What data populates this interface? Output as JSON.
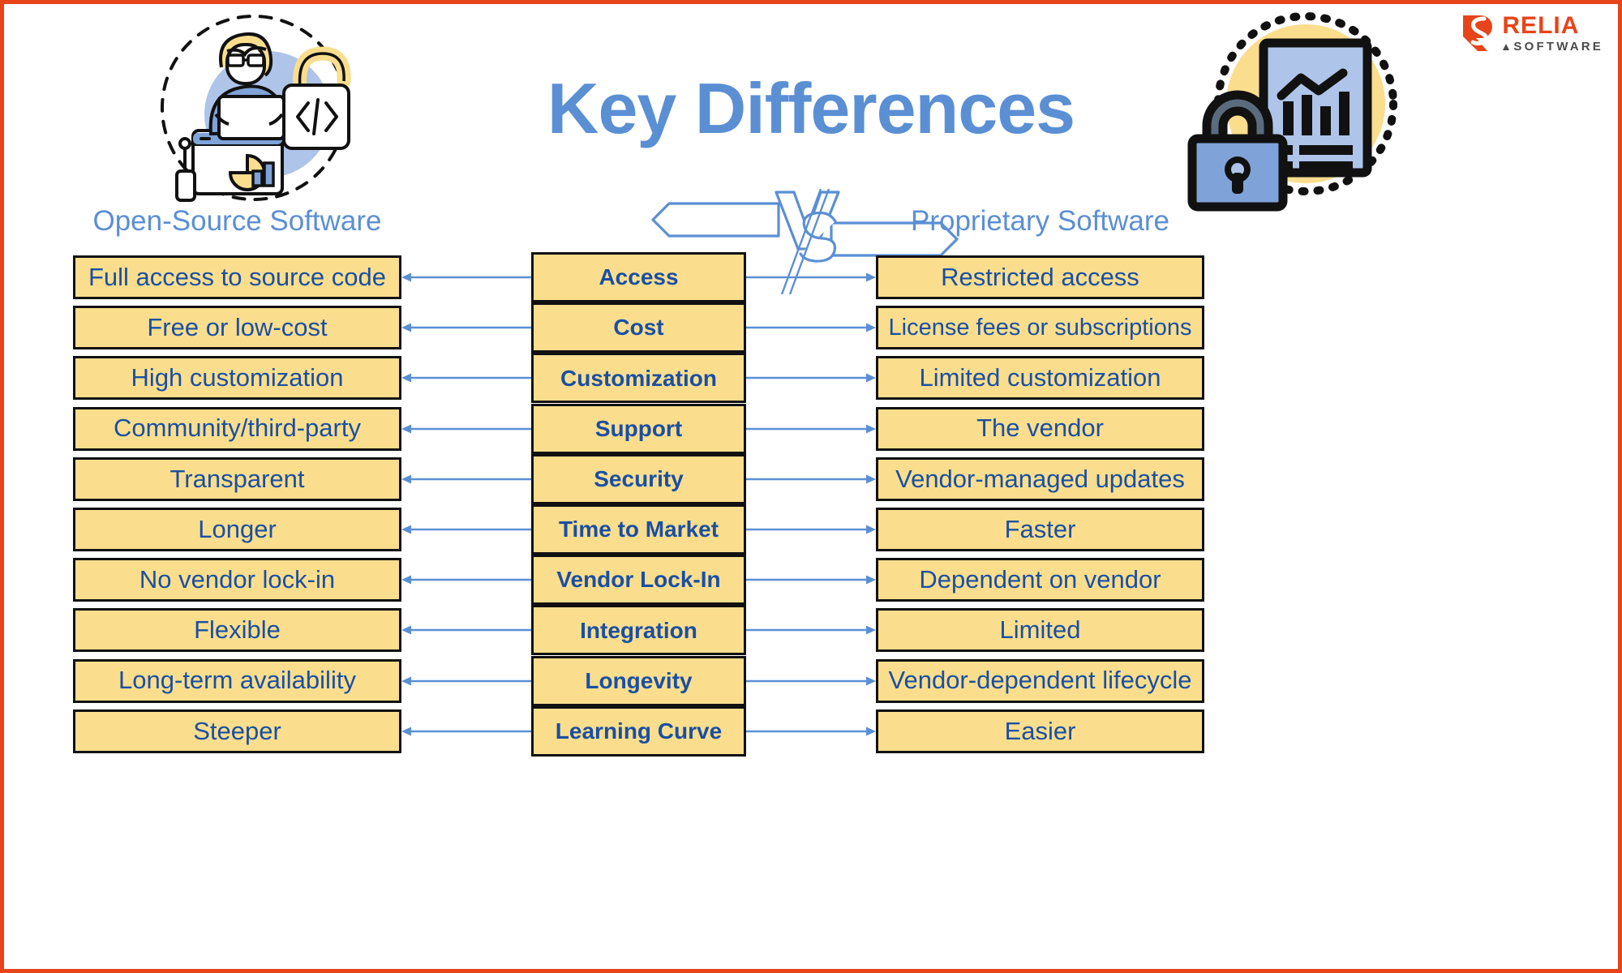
{
  "brand": {
    "name": "RELIA",
    "subtitle": "SOFTWARE",
    "logo_icon": "relia-r-mark-icon",
    "brand_color": "#E8441A",
    "subtitle_color": "#4A4A4A"
  },
  "header": {
    "title": "Key Differences",
    "title_color": "#5B8FD4",
    "vs_label": "V/S",
    "vs_icon": "versus-arrows-icon",
    "left_illustration_icon": "open-source-developer-icon",
    "right_illustration_icon": "proprietary-locked-document-icon"
  },
  "columns": {
    "left_heading": "Open-Source Software",
    "center_heading": "",
    "right_heading": "Proprietary Software"
  },
  "theme": {
    "cell_fill": "#FADE8D",
    "cell_border": "#111111",
    "cell_text": "#1A4FA3",
    "arrow_color": "#5B8FD4",
    "page_border": "#E8441A"
  },
  "rows": [
    {
      "criterion": "Access",
      "open_source": "Full access to source code",
      "proprietary": "Restricted access"
    },
    {
      "criterion": "Cost",
      "open_source": "Free or low-cost",
      "proprietary": "License fees or subscriptions"
    },
    {
      "criterion": "Customization",
      "open_source": "High customization",
      "proprietary": "Limited customization"
    },
    {
      "criterion": "Support",
      "open_source": "Community/third-party",
      "proprietary": "The vendor"
    },
    {
      "criterion": "Security",
      "open_source": "Transparent",
      "proprietary": "Vendor-managed updates"
    },
    {
      "criterion": "Time to Market",
      "open_source": "Longer",
      "proprietary": "Faster"
    },
    {
      "criterion": "Vendor Lock-In",
      "open_source": "No vendor lock-in",
      "proprietary": "Dependent on vendor"
    },
    {
      "criterion": "Integration",
      "open_source": "Flexible",
      "proprietary": "Limited"
    },
    {
      "criterion": "Longevity",
      "open_source": "Long-term availability",
      "proprietary": "Vendor-dependent lifecycle"
    },
    {
      "criterion": "Learning Curve",
      "open_source": "Steeper",
      "proprietary": "Easier"
    }
  ]
}
